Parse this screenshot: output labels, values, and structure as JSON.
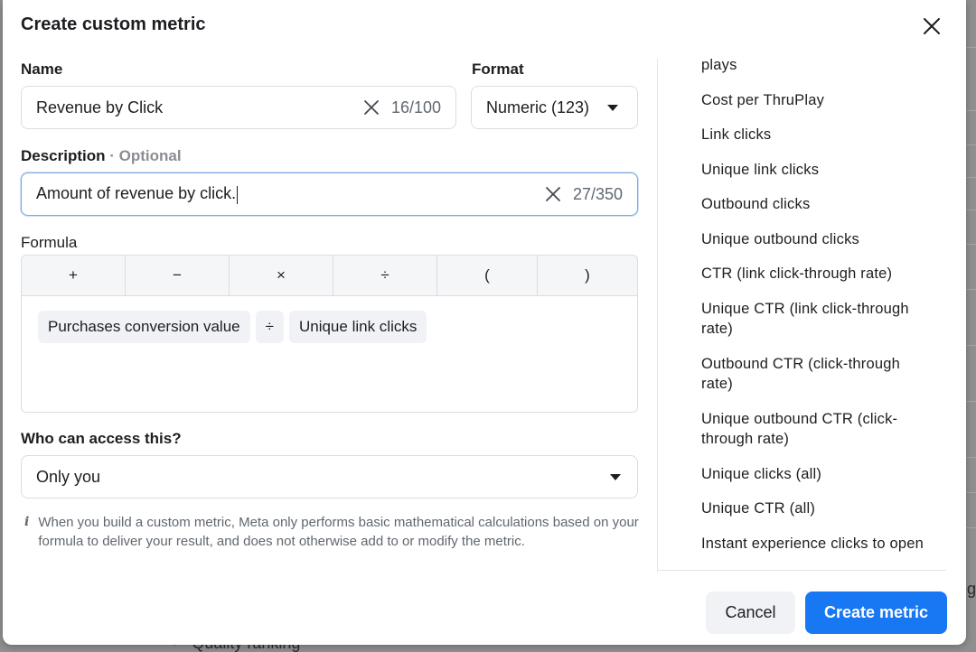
{
  "dialog": {
    "title": "Create custom metric",
    "close_icon": "close-icon"
  },
  "name_field": {
    "label": "Name",
    "value": "Revenue by Click",
    "char_count": "16/100",
    "clear_icon": "clear-icon"
  },
  "format_field": {
    "label": "Format",
    "selected": "Numeric (123)",
    "arrow_icon": "dropdown-arrow-icon"
  },
  "description_field": {
    "label": "Description",
    "optional_label": " · Optional",
    "value": "Amount of revenue by click.",
    "char_count": "27/350",
    "clear_icon": "clear-icon"
  },
  "formula": {
    "label": "Formula",
    "operators": [
      "+",
      "−",
      "×",
      "÷",
      "(",
      ")"
    ],
    "tokens": [
      "Purchases conversion value",
      "÷",
      "Unique link clicks"
    ]
  },
  "access": {
    "label": "Who can access this?",
    "selected": "Only you",
    "arrow_icon": "dropdown-arrow-icon"
  },
  "info_note": {
    "icon": "info-icon",
    "text": "When you build a custom metric, Meta only performs basic mathematical calculations based on your formula to deliver your result, and does not otherwise add to or modify the metric."
  },
  "metric_list": [
    "plays",
    "Cost per ThruPlay",
    "Link clicks",
    "Unique link clicks",
    "Outbound clicks",
    "Unique outbound clicks",
    "CTR (link click-through rate)",
    "Unique CTR (link click-through rate)",
    "Outbound CTR (click-through rate)",
    "Unique outbound CTR (click-through rate)",
    "Unique clicks (all)",
    "Unique CTR (all)",
    "Instant experience clicks to open"
  ],
  "footer": {
    "cancel_label": "Cancel",
    "create_label": "Create metric"
  },
  "backdrop": {
    "row_text": "Quality ranking",
    "edge_text": "g"
  },
  "colors": {
    "primary": "#1877f2",
    "focus_border": "#7ea8e0",
    "backdrop": "#8f8f8f"
  }
}
